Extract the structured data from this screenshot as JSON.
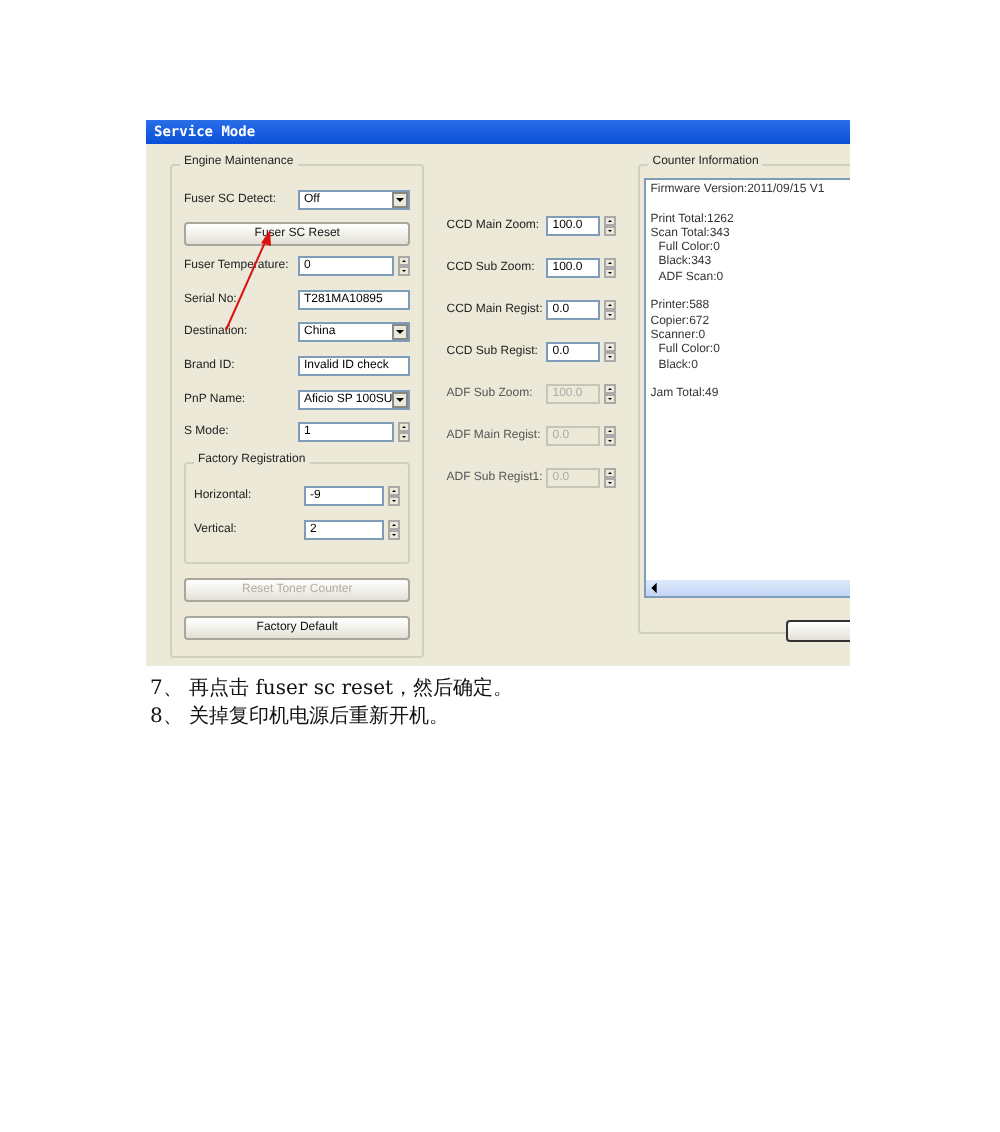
{
  "window": {
    "title": "Service Mode"
  },
  "engine_maintenance": {
    "title": "Engine Maintenance",
    "items": [
      {
        "kind": "dropdown",
        "label": "Fuser SC Detect:",
        "value": "Off",
        "disabled": false
      },
      {
        "kind": "button",
        "label": "Fuser SC Reset",
        "disabled": false
      },
      {
        "kind": "spin",
        "label": "Fuser Temperature:",
        "value": "0",
        "disabled": false
      },
      {
        "kind": "text",
        "label": "Serial No:",
        "value": "T281MA10895",
        "disabled": false
      },
      {
        "kind": "dropdown",
        "label": "Destination:",
        "value": "China",
        "disabled": false
      },
      {
        "kind": "text",
        "label": "Brand ID:",
        "value": "Invalid ID check",
        "disabled": false
      },
      {
        "kind": "dropdown",
        "label": "PnP Name:",
        "value": "Aficio SP 100SU",
        "disabled": false
      },
      {
        "kind": "spin",
        "label": "S Mode:",
        "value": "1",
        "disabled": false
      }
    ],
    "factory_registration": {
      "title": "Factory Registration",
      "items": [
        {
          "label": "Horizontal:",
          "value": "-9",
          "disabled": false
        },
        {
          "label": "Vertical:",
          "value": "2",
          "disabled": false
        }
      ]
    },
    "buttons": [
      {
        "label": "Reset Toner Counter",
        "disabled": true
      },
      {
        "label": "Factory Default",
        "disabled": false
      }
    ]
  },
  "scanner_settings": [
    {
      "label": "CCD Main Zoom:",
      "value": "100.0",
      "disabled": false
    },
    {
      "label": "CCD Sub Zoom:",
      "value": "100.0",
      "disabled": false
    },
    {
      "label": "CCD Main Regist:",
      "value": "0.0",
      "disabled": false
    },
    {
      "label": "CCD Sub Regist:",
      "value": "0.0",
      "disabled": false
    },
    {
      "label": "ADF Sub Zoom:",
      "value": "100.0",
      "disabled": true
    },
    {
      "label": "ADF Main Regist:",
      "value": "0.0",
      "disabled": true
    },
    {
      "label": "ADF Sub Regist1:",
      "value": "0.0",
      "disabled": true
    }
  ],
  "counter_information": {
    "title": "Counter Information",
    "sections": [
      [
        {
          "text": "Firmware Version:2011/09/15 V1"
        }
      ],
      [
        {
          "text": "Print Total:1262"
        },
        {
          "text": "Scan Total:343",
          "children": [
            {
              "text": "Full Color:0"
            },
            {
              "text": "Black:343"
            },
            {
              "text": "ADF Scan:0"
            }
          ]
        }
      ],
      [
        {
          "text": "Printer:588"
        },
        {
          "text": "Copier:672"
        },
        {
          "text": "Scanner:0",
          "children": [
            {
              "text": "Full Color:0"
            },
            {
              "text": "Black:0"
            }
          ]
        }
      ],
      [
        {
          "text": "Jam Total:49"
        }
      ]
    ]
  },
  "instructions": [
    "7、 再点击 fuser sc reset，然后确定。",
    "8、 关掉复印机电源后重新开机。"
  ]
}
